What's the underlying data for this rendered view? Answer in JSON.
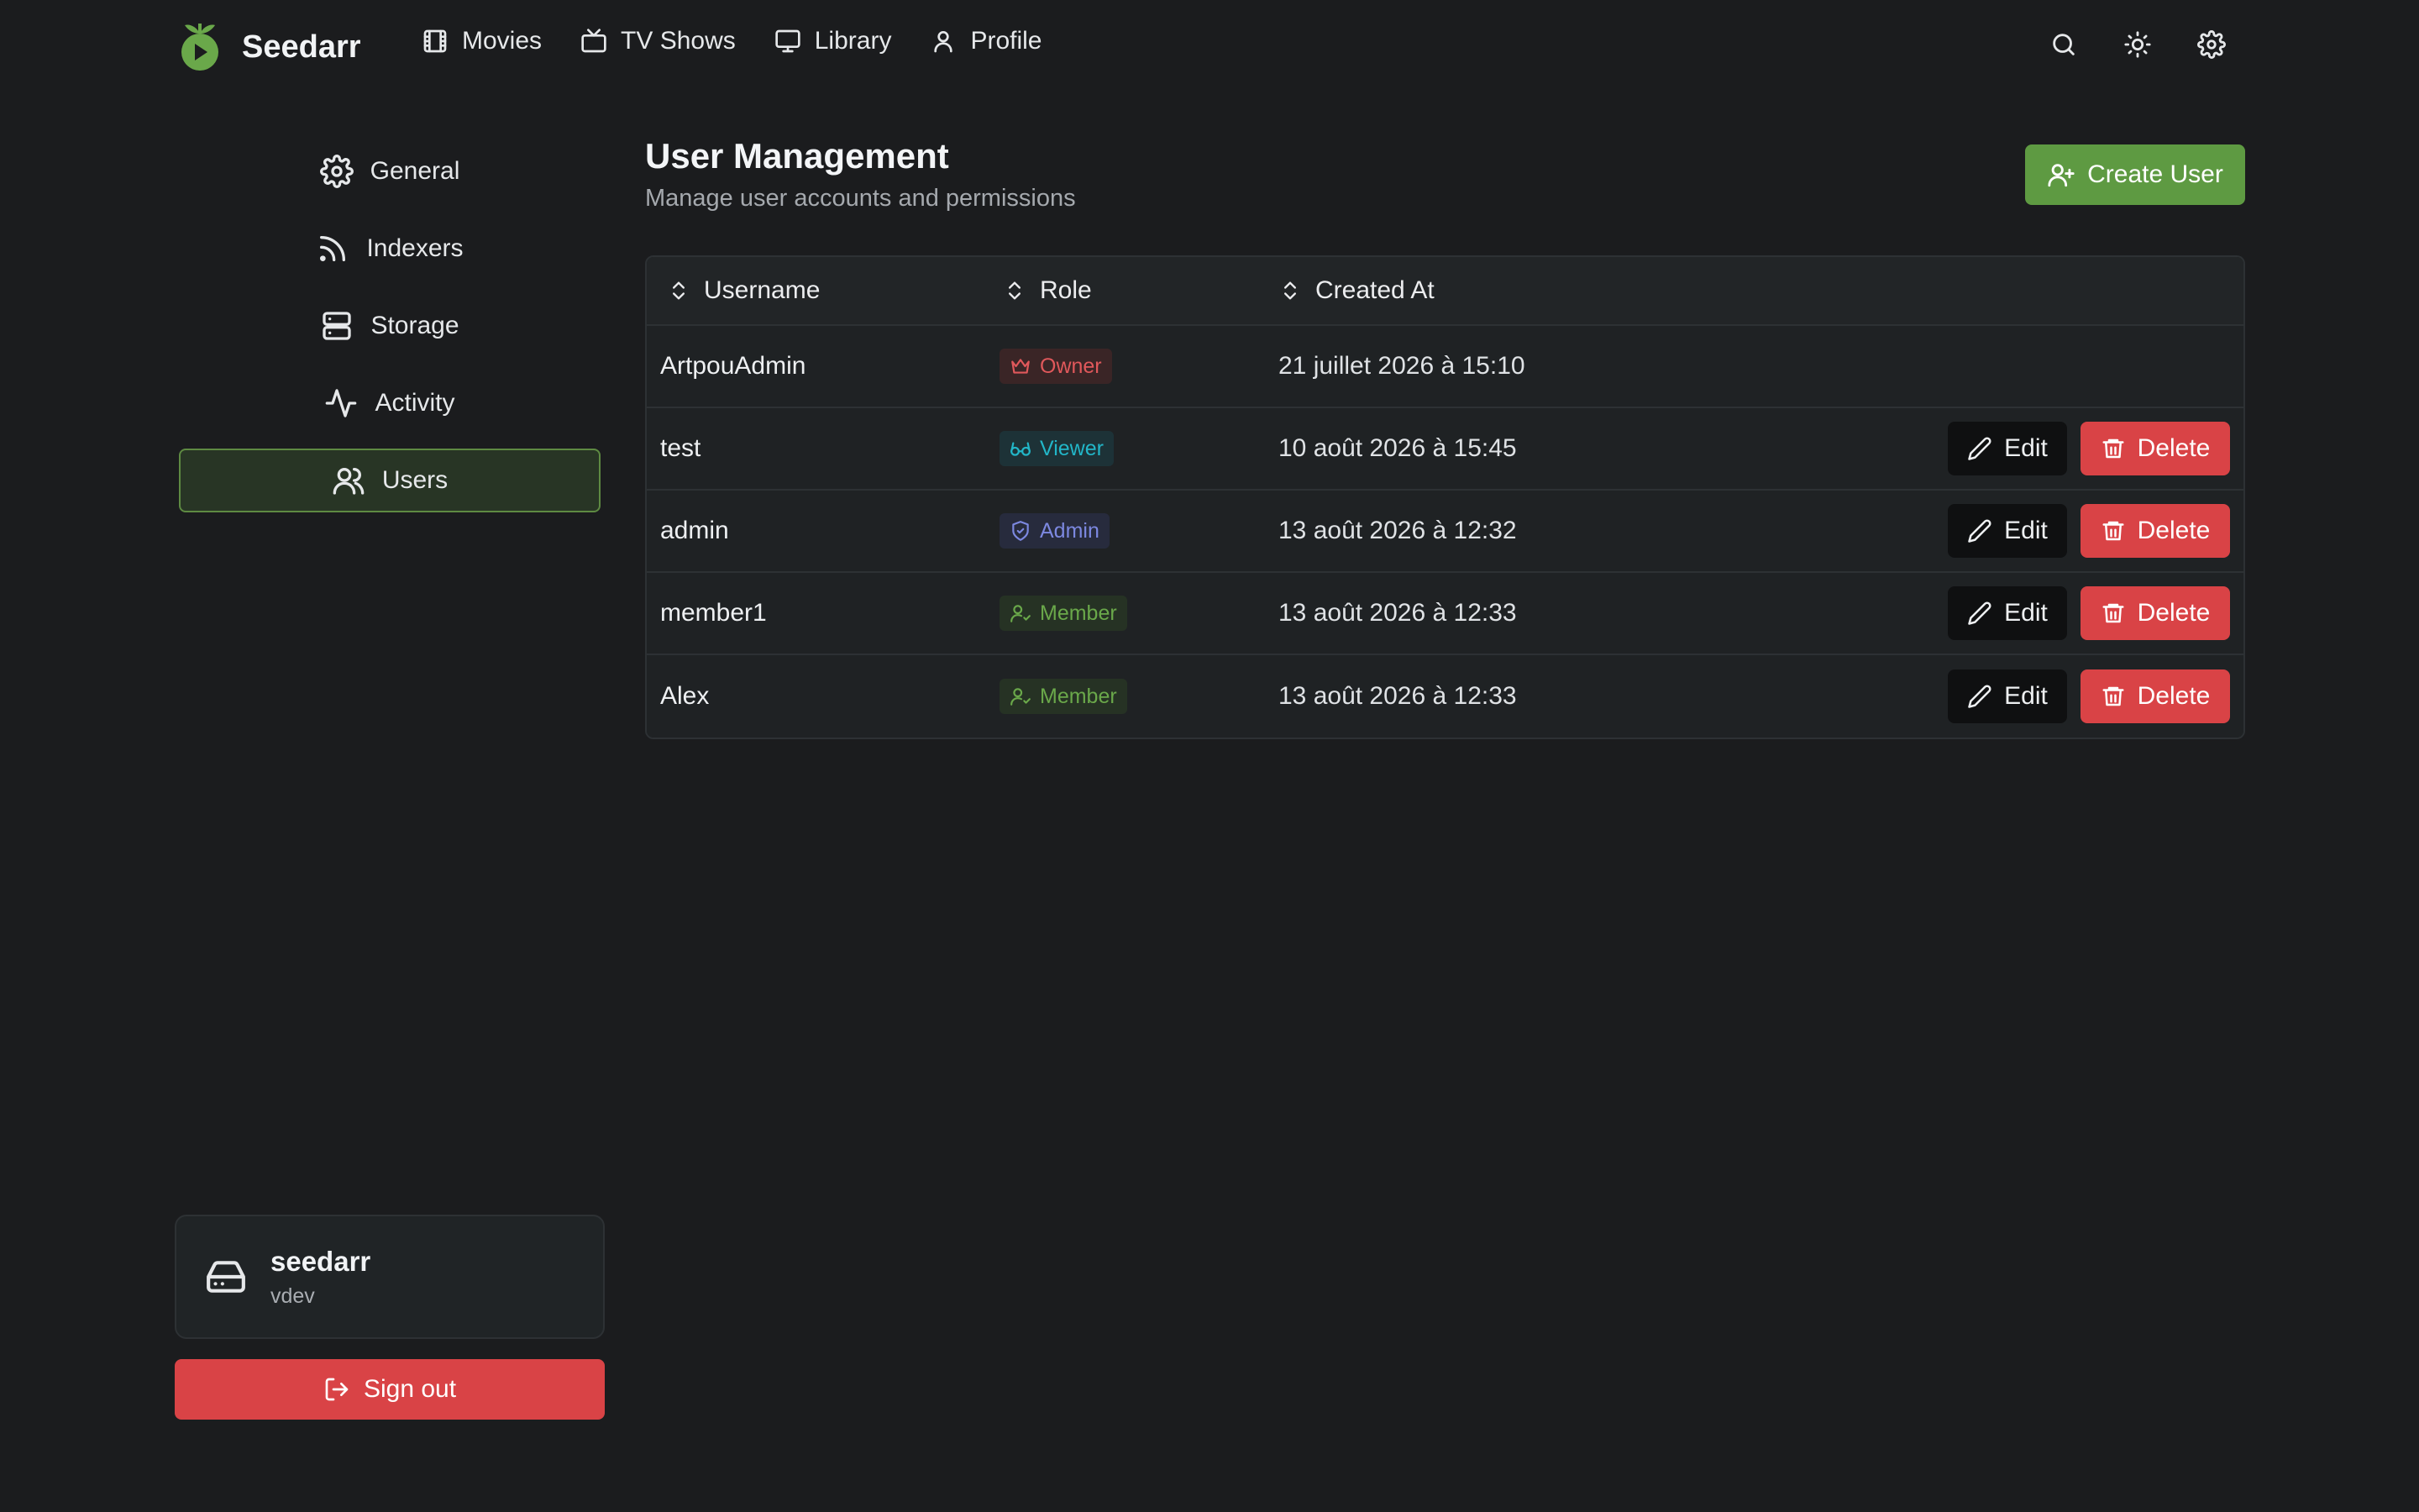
{
  "app": {
    "name": "Seedarr"
  },
  "nav": {
    "items": [
      {
        "label": "Movies",
        "icon": "film-icon"
      },
      {
        "label": "TV Shows",
        "icon": "tv-icon"
      },
      {
        "label": "Library",
        "icon": "monitor-icon"
      },
      {
        "label": "Profile",
        "icon": "user-icon"
      }
    ],
    "actions": [
      "search-icon",
      "sun-icon",
      "gear-icon"
    ]
  },
  "sidebar": {
    "items": [
      {
        "label": "General",
        "icon": "gear-icon"
      },
      {
        "label": "Indexers",
        "icon": "rss-icon"
      },
      {
        "label": "Storage",
        "icon": "server-icon"
      },
      {
        "label": "Activity",
        "icon": "activity-icon"
      },
      {
        "label": "Users",
        "icon": "users-icon",
        "active": true
      }
    ],
    "server": {
      "name": "seedarr",
      "version": "vdev"
    },
    "signout_label": "Sign out"
  },
  "main": {
    "title": "User Management",
    "subtitle": "Manage user accounts and permissions",
    "create_label": "Create User",
    "columns": [
      "Username",
      "Role",
      "Created At"
    ],
    "edit_label": "Edit",
    "delete_label": "Delete",
    "users": [
      {
        "username": "ArtpouAdmin",
        "role": "Owner",
        "created": "21 juillet 2026 à 15:10",
        "actions": false
      },
      {
        "username": "test",
        "role": "Viewer",
        "created": "10 août 2026 à 15:45",
        "actions": true
      },
      {
        "username": "admin",
        "role": "Admin",
        "created": "13 août 2026 à 12:32",
        "actions": true
      },
      {
        "username": "member1",
        "role": "Member",
        "created": "13 août 2026 à 12:33",
        "actions": true
      },
      {
        "username": "Alex",
        "role": "Member",
        "created": "13 août 2026 à 12:33",
        "actions": true
      }
    ]
  },
  "colors": {
    "background": "#1b1c1e",
    "accent": "#5e9a42",
    "danger": "#d94346",
    "owner": "#e0585b",
    "viewer": "#22b6c8",
    "admin": "#7c88e0",
    "member": "#6aa84a"
  }
}
